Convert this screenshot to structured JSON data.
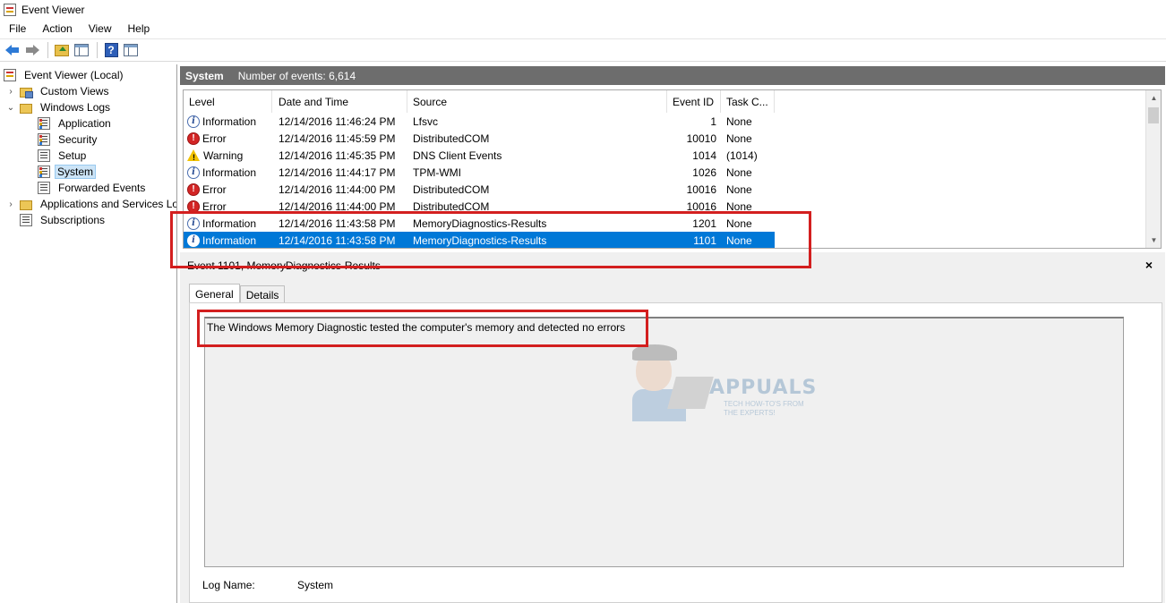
{
  "window": {
    "title": "Event Viewer"
  },
  "menu": [
    "File",
    "Action",
    "View",
    "Help"
  ],
  "toolbar": {
    "back_icon": "back-arrow-icon",
    "forward_icon": "forward-arrow-icon",
    "up_icon": "folder-up-icon",
    "show_hide_icon": "show-hide-console-tree-icon",
    "help_icon": "help-icon",
    "help_glyph": "?",
    "action_pane_icon": "show-hide-action-pane-icon"
  },
  "tree": {
    "root": "Event Viewer (Local)",
    "custom_views": "Custom Views",
    "windows_logs": "Windows Logs",
    "application": "Application",
    "security": "Security",
    "setup": "Setup",
    "system": "System",
    "forwarded": "Forwarded Events",
    "apps_services": "Applications and Services Lo",
    "subscriptions": "Subscriptions"
  },
  "header": {
    "title": "System",
    "count": "Number of events: 6,614"
  },
  "table": {
    "columns": [
      "Level",
      "Date and Time",
      "Source",
      "Event ID",
      "Task C..."
    ],
    "rows": [
      {
        "level": "Information",
        "date": "12/14/2016 11:46:24 PM",
        "source": "Lfsvc",
        "id": "1",
        "task": "None",
        "type": "information"
      },
      {
        "level": "Error",
        "date": "12/14/2016 11:45:59 PM",
        "source": "DistributedCOM",
        "id": "10010",
        "task": "None",
        "type": "error"
      },
      {
        "level": "Warning",
        "date": "12/14/2016 11:45:35 PM",
        "source": "DNS Client Events",
        "id": "1014",
        "task": "(1014)",
        "type": "warning"
      },
      {
        "level": "Information",
        "date": "12/14/2016 11:44:17 PM",
        "source": "TPM-WMI",
        "id": "1026",
        "task": "None",
        "type": "information"
      },
      {
        "level": "Error",
        "date": "12/14/2016 11:44:00 PM",
        "source": "DistributedCOM",
        "id": "10016",
        "task": "None",
        "type": "error"
      },
      {
        "level": "Error",
        "date": "12/14/2016 11:44:00 PM",
        "source": "DistributedCOM",
        "id": "10016",
        "task": "None",
        "type": "error"
      },
      {
        "level": "Information",
        "date": "12/14/2016 11:43:58 PM",
        "source": "MemoryDiagnostics-Results",
        "id": "1201",
        "task": "None",
        "type": "information"
      },
      {
        "level": "Information",
        "date": "12/14/2016 11:43:58 PM",
        "source": "MemoryDiagnostics-Results",
        "id": "1101",
        "task": "None",
        "type": "information"
      }
    ]
  },
  "detail": {
    "title": "Event 1101, MemoryDiagnostics-Results",
    "close": "×",
    "tabs": [
      "General",
      "Details"
    ],
    "description": "The Windows Memory Diagnostic tested the computer's memory and detected no errors",
    "log_name_label": "Log Name:",
    "log_name_value": "System"
  },
  "watermark": {
    "text": "APPUALS",
    "sub": "TECH HOW-TO'S FROM THE EXPERTS!"
  },
  "colors": {
    "selection": "#0078d7",
    "highlight_box": "#d31f1f",
    "header_bg": "#6d6d6d"
  }
}
